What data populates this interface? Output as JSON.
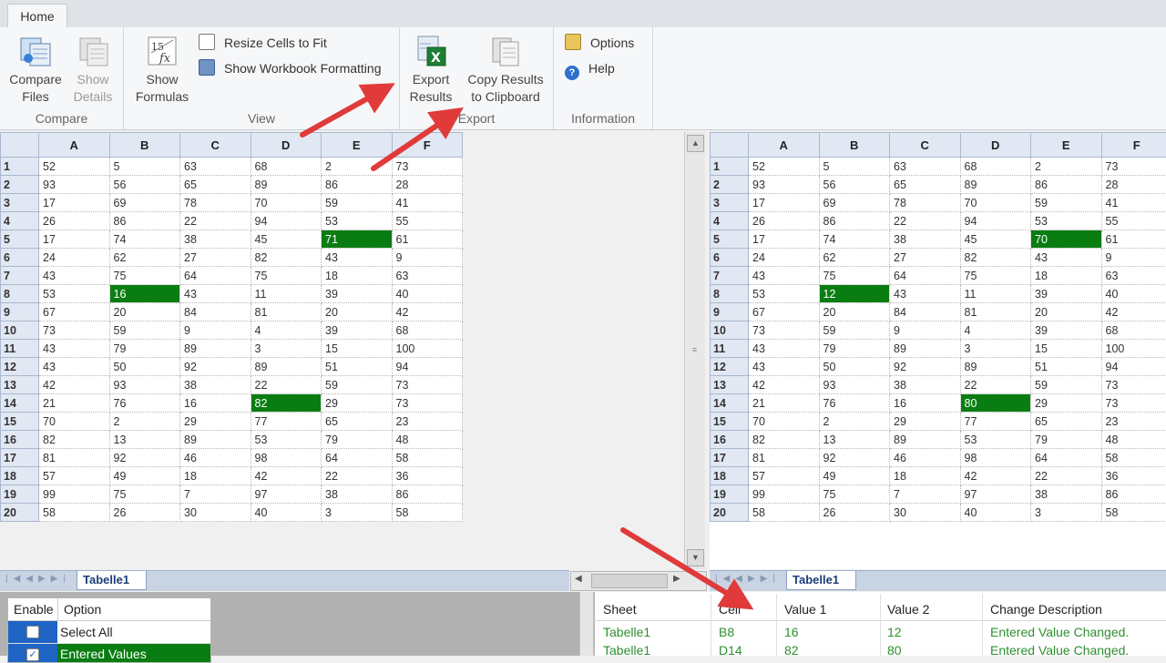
{
  "ribbon": {
    "tab": "Home",
    "compare": {
      "label": "Compare",
      "compare_files": "Compare\nFiles",
      "show_details": "Show\nDetails"
    },
    "view": {
      "label": "View",
      "show_formulas": "Show\nFormulas",
      "resize_cells": "Resize Cells to Fit",
      "show_formatting": "Show Workbook Formatting"
    },
    "export": {
      "label": "Export",
      "export_results": "Export\nResults",
      "copy_results": "Copy Results\nto Clipboard"
    },
    "information": {
      "label": "Information",
      "options": "Options",
      "help": "Help"
    }
  },
  "grid": {
    "columns": [
      "A",
      "B",
      "C",
      "D",
      "E",
      "F"
    ],
    "left": [
      [
        52,
        5,
        63,
        68,
        2,
        73
      ],
      [
        93,
        56,
        65,
        89,
        86,
        28
      ],
      [
        17,
        69,
        78,
        70,
        59,
        41
      ],
      [
        26,
        86,
        22,
        94,
        53,
        55
      ],
      [
        17,
        74,
        38,
        45,
        71,
        61
      ],
      [
        24,
        62,
        27,
        82,
        43,
        9
      ],
      [
        43,
        75,
        64,
        75,
        18,
        63
      ],
      [
        53,
        16,
        43,
        11,
        39,
        40
      ],
      [
        67,
        20,
        84,
        81,
        20,
        42
      ],
      [
        73,
        59,
        9,
        4,
        39,
        68
      ],
      [
        43,
        79,
        89,
        3,
        15,
        100
      ],
      [
        43,
        50,
        92,
        89,
        51,
        94
      ],
      [
        42,
        93,
        38,
        22,
        59,
        73
      ],
      [
        21,
        76,
        16,
        82,
        29,
        73
      ],
      [
        70,
        2,
        29,
        77,
        65,
        23
      ],
      [
        82,
        13,
        89,
        53,
        79,
        48
      ],
      [
        81,
        92,
        46,
        98,
        64,
        58
      ],
      [
        57,
        49,
        18,
        42,
        22,
        36
      ],
      [
        99,
        75,
        7,
        97,
        38,
        86
      ],
      [
        58,
        26,
        30,
        40,
        3,
        58
      ]
    ],
    "right": [
      [
        52,
        5,
        63,
        68,
        2,
        73
      ],
      [
        93,
        56,
        65,
        89,
        86,
        28
      ],
      [
        17,
        69,
        78,
        70,
        59,
        41
      ],
      [
        26,
        86,
        22,
        94,
        53,
        55
      ],
      [
        17,
        74,
        38,
        45,
        70,
        61
      ],
      [
        24,
        62,
        27,
        82,
        43,
        9
      ],
      [
        43,
        75,
        64,
        75,
        18,
        63
      ],
      [
        53,
        12,
        43,
        11,
        39,
        40
      ],
      [
        67,
        20,
        84,
        81,
        20,
        42
      ],
      [
        73,
        59,
        9,
        4,
        39,
        68
      ],
      [
        43,
        79,
        89,
        3,
        15,
        100
      ],
      [
        43,
        50,
        92,
        89,
        51,
        94
      ],
      [
        42,
        93,
        38,
        22,
        59,
        73
      ],
      [
        21,
        76,
        16,
        80,
        29,
        73
      ],
      [
        70,
        2,
        29,
        77,
        65,
        23
      ],
      [
        82,
        13,
        89,
        53,
        79,
        48
      ],
      [
        81,
        92,
        46,
        98,
        64,
        58
      ],
      [
        57,
        49,
        18,
        42,
        22,
        36
      ],
      [
        99,
        75,
        7,
        97,
        38,
        86
      ],
      [
        58,
        26,
        30,
        40,
        3,
        58
      ]
    ],
    "highlight_color": "#0a7d12",
    "highlights": [
      [
        5,
        "E"
      ],
      [
        8,
        "B"
      ],
      [
        14,
        "D"
      ]
    ]
  },
  "sheets": {
    "left_tab": "Tabelle1",
    "right_tab": "Tabelle1"
  },
  "options": {
    "headers": [
      "Enable",
      "Option"
    ],
    "rows": [
      {
        "checked": false,
        "label": "Select All"
      },
      {
        "checked": true,
        "label": "Entered Values"
      }
    ]
  },
  "results": {
    "headers": [
      "Sheet",
      "Cell",
      "Value 1",
      "Value 2",
      "Change Description"
    ],
    "rows": [
      [
        "Tabelle1",
        "B8",
        "16",
        "12",
        "Entered Value Changed."
      ],
      [
        "Tabelle1",
        "D14",
        "82",
        "80",
        "Entered Value Changed."
      ]
    ]
  }
}
